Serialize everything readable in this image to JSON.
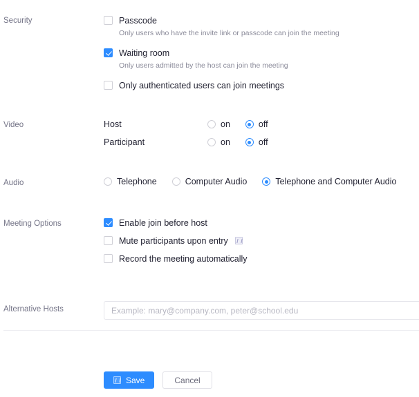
{
  "sections": {
    "security": {
      "label": "Security",
      "options": [
        {
          "name": "passcode",
          "label": "Passcode",
          "checked": false,
          "hint": "Only users who have the invite link or passcode can join the meeting"
        },
        {
          "name": "waiting-room",
          "label": "Waiting room",
          "checked": true,
          "hint": "Only users admitted by the host can join the meeting"
        },
        {
          "name": "only-authenticated-users",
          "label": "Only authenticated users can join meetings",
          "checked": false,
          "hint": ""
        }
      ]
    },
    "video": {
      "label": "Video",
      "rows": [
        {
          "name": "host",
          "label": "Host",
          "options": [
            "on",
            "off"
          ],
          "selected": "off"
        },
        {
          "name": "participant",
          "label": "Participant",
          "options": [
            "on",
            "off"
          ],
          "selected": "off"
        }
      ]
    },
    "audio": {
      "label": "Audio",
      "options": [
        "Telephone",
        "Computer Audio",
        "Telephone and Computer Audio"
      ],
      "selected": "Telephone and Computer Audio"
    },
    "meeting_options": {
      "label": "Meeting Options",
      "options": [
        {
          "name": "enable-join-before-host",
          "label": "Enable join before host",
          "checked": true,
          "icon": false
        },
        {
          "name": "mute-participants-upon-entry",
          "label": "Mute participants upon entry",
          "checked": false,
          "icon": true
        },
        {
          "name": "record-the-meeting-automatically",
          "label": "Record the meeting automatically",
          "checked": false,
          "icon": false
        }
      ]
    },
    "alternative_hosts": {
      "label": "Alternative Hosts",
      "value": "",
      "placeholder": "Example: mary@company.com, peter@school.edu"
    }
  },
  "actions": {
    "save_label": "Save",
    "cancel_label": "Cancel",
    "save_icon": "broken-image-icon"
  },
  "colors": {
    "accent": "#2d8cff",
    "label_text": "#747487",
    "body_text": "#232333",
    "hint_text": "#8b8b9a",
    "border": "#e4e4ea"
  }
}
